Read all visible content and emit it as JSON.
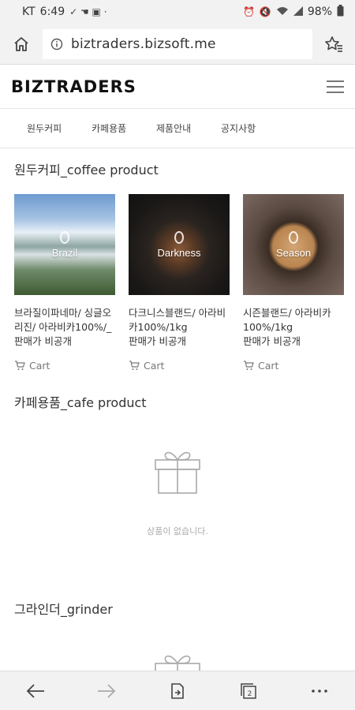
{
  "status": {
    "carrier": "KT",
    "time": "6:49",
    "battery": "98%"
  },
  "browser": {
    "url": "biztraders.bizsoft.me",
    "tab_count": "2"
  },
  "site": {
    "logo": "BIZTRADERS"
  },
  "nav": [
    "원두커피",
    "카페용품",
    "제품안내",
    "공지사항"
  ],
  "sections": {
    "coffee": {
      "title": "원두커피_coffee product",
      "products": [
        {
          "label": "Brazil",
          "name": "브라질이파네마/ 싱글오리진/ 아라비카100%/_",
          "price": "판매가 비공개",
          "cart": "Cart"
        },
        {
          "label": "Darkness",
          "name": "다크니스블랜드/ 아라비카100%/1kg",
          "price": "판매가 비공개",
          "cart": "Cart"
        },
        {
          "label": "Season",
          "name": "시즌블랜드/ 아라비카100%/1kg",
          "price": "판매가 비공개",
          "cart": "Cart"
        }
      ]
    },
    "cafe": {
      "title": "카페용품_cafe product",
      "empty_text": "상품이 없습니다."
    },
    "grinder": {
      "title": "그라인더_grinder"
    }
  },
  "colors": {
    "accent": "#111111",
    "muted": "#aaaaaa"
  }
}
